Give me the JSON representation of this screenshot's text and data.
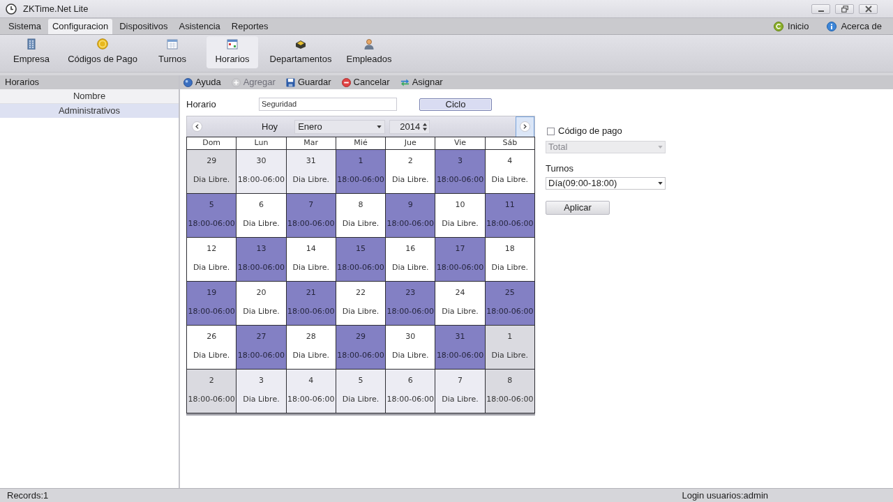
{
  "window": {
    "title": "ZKTime.Net Lite"
  },
  "menu": [
    {
      "label": "Sistema",
      "selected": false
    },
    {
      "label": "Configuracion",
      "selected": true
    },
    {
      "label": "Dispositivos",
      "selected": false
    },
    {
      "label": "Asistencia",
      "selected": false
    },
    {
      "label": "Reportes",
      "selected": false
    }
  ],
  "menu_right": [
    {
      "label": "Inicio"
    },
    {
      "label": "Acerca de"
    }
  ],
  "toolbar": [
    {
      "label": "Empresa",
      "selected": false
    },
    {
      "label": "Códigos de Pago",
      "selected": false
    },
    {
      "label": "Turnos",
      "selected": false
    },
    {
      "label": "Horarios",
      "selected": true
    },
    {
      "label": "Departamentos",
      "selected": false
    },
    {
      "label": "Empleados",
      "selected": false
    }
  ],
  "sidebar": {
    "title": "Horarios",
    "column": "Nombre",
    "rows": [
      {
        "label": "Administrativos",
        "selected": true
      }
    ]
  },
  "actions": [
    {
      "label": "Ayuda",
      "disabled": false
    },
    {
      "label": "Agregar",
      "disabled": true
    },
    {
      "label": "Guardar",
      "disabled": false
    },
    {
      "label": "Cancelar",
      "disabled": false
    },
    {
      "label": "Asignar",
      "disabled": false
    }
  ],
  "schedule": {
    "label": "Horario",
    "value": "Seguridad",
    "button": "Ciclo"
  },
  "calendar": {
    "today": "Hoy",
    "month": "Enero",
    "year": "2014",
    "weekdays": [
      "Dom",
      "Lun",
      "Mar",
      "Mié",
      "Jue",
      "Vie",
      "Sáb"
    ],
    "weeks": [
      [
        {
          "day": "29",
          "text": "Dia Libre.",
          "kind": "outside"
        },
        {
          "day": "30",
          "text": "18:00-06:00",
          "kind": "outside"
        },
        {
          "day": "31",
          "text": "Dia Libre.",
          "kind": "outside"
        },
        {
          "day": "1",
          "text": "18:00-06:00",
          "kind": "shift"
        },
        {
          "day": "2",
          "text": "Dia Libre.",
          "kind": "free"
        },
        {
          "day": "3",
          "text": "18:00-06:00",
          "kind": "shift"
        },
        {
          "day": "4",
          "text": "Dia Libre.",
          "kind": "free"
        }
      ],
      [
        {
          "day": "5",
          "text": "18:00-06:00",
          "kind": "shift"
        },
        {
          "day": "6",
          "text": "Dia Libre.",
          "kind": "free"
        },
        {
          "day": "7",
          "text": "18:00-06:00",
          "kind": "shift"
        },
        {
          "day": "8",
          "text": "Dia Libre.",
          "kind": "free"
        },
        {
          "day": "9",
          "text": "18:00-06:00",
          "kind": "shift"
        },
        {
          "day": "10",
          "text": "Dia Libre.",
          "kind": "free"
        },
        {
          "day": "11",
          "text": "18:00-06:00",
          "kind": "shift"
        }
      ],
      [
        {
          "day": "12",
          "text": "Dia Libre.",
          "kind": "free"
        },
        {
          "day": "13",
          "text": "18:00-06:00",
          "kind": "shift"
        },
        {
          "day": "14",
          "text": "Dia Libre.",
          "kind": "free"
        },
        {
          "day": "15",
          "text": "18:00-06:00",
          "kind": "shift"
        },
        {
          "day": "16",
          "text": "Dia Libre.",
          "kind": "free"
        },
        {
          "day": "17",
          "text": "18:00-06:00",
          "kind": "shift"
        },
        {
          "day": "18",
          "text": "Dia Libre.",
          "kind": "free"
        }
      ],
      [
        {
          "day": "19",
          "text": "18:00-06:00",
          "kind": "shift"
        },
        {
          "day": "20",
          "text": "Dia Libre.",
          "kind": "free"
        },
        {
          "day": "21",
          "text": "18:00-06:00",
          "kind": "shift"
        },
        {
          "day": "22",
          "text": "Dia Libre.",
          "kind": "free"
        },
        {
          "day": "23",
          "text": "18:00-06:00",
          "kind": "shift"
        },
        {
          "day": "24",
          "text": "Dia Libre.",
          "kind": "free"
        },
        {
          "day": "25",
          "text": "18:00-06:00",
          "kind": "shift"
        }
      ],
      [
        {
          "day": "26",
          "text": "Dia Libre.",
          "kind": "free"
        },
        {
          "day": "27",
          "text": "18:00-06:00",
          "kind": "shift"
        },
        {
          "day": "28",
          "text": "Dia Libre.",
          "kind": "free"
        },
        {
          "day": "29",
          "text": "18:00-06:00",
          "kind": "shift"
        },
        {
          "day": "30",
          "text": "Dia Libre.",
          "kind": "free"
        },
        {
          "day": "31",
          "text": "18:00-06:00",
          "kind": "shift"
        },
        {
          "day": "1",
          "text": "Dia Libre.",
          "kind": "outside"
        }
      ],
      [
        {
          "day": "2",
          "text": "18:00-06:00",
          "kind": "outside"
        },
        {
          "day": "3",
          "text": "Dia Libre.",
          "kind": "outside"
        },
        {
          "day": "4",
          "text": "18:00-06:00",
          "kind": "outside"
        },
        {
          "day": "5",
          "text": "Dia Libre.",
          "kind": "outside"
        },
        {
          "day": "6",
          "text": "18:00-06:00",
          "kind": "outside"
        },
        {
          "day": "7",
          "text": "Dia Libre.",
          "kind": "outside"
        },
        {
          "day": "8",
          "text": "18:00-06:00",
          "kind": "outside"
        }
      ]
    ]
  },
  "side_panel": {
    "pay_code": {
      "label": "Código de pago",
      "checked": false,
      "value": "Total",
      "disabled": true
    },
    "shifts": {
      "label": "Turnos",
      "value": "Día(09:00-18:00)"
    },
    "button": "Aplicar"
  },
  "status_bar": {
    "records": "Records:1",
    "login": "Login usuarios:admin"
  }
}
